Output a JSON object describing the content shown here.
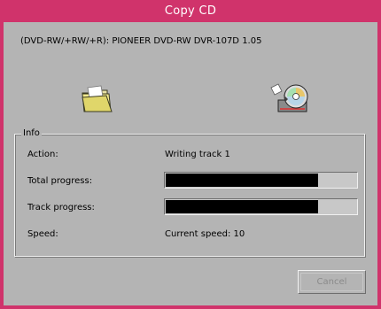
{
  "window": {
    "title": "Copy CD"
  },
  "device": {
    "label": "(DVD-RW/+RW/+R):  PIONEER DVD-RW  DVR-107D 1.05"
  },
  "icons": {
    "source": "folder-icon",
    "target": "cd-writer-icon"
  },
  "info": {
    "group_title": "Info",
    "action_label": "Action:",
    "action_value": "Writing track 1",
    "total_progress_label": "Total progress:",
    "total_progress_fraction": 0.8,
    "track_progress_label": "Track progress:",
    "track_progress_fraction": 0.8,
    "speed_label": "Speed:",
    "speed_value": "Current speed: 10"
  },
  "buttons": {
    "cancel_label": "Cancel",
    "cancel_enabled": false
  },
  "colors": {
    "titlebar": "#d0336b",
    "background": "#b4b4b4",
    "progress_fill": "#000000"
  }
}
